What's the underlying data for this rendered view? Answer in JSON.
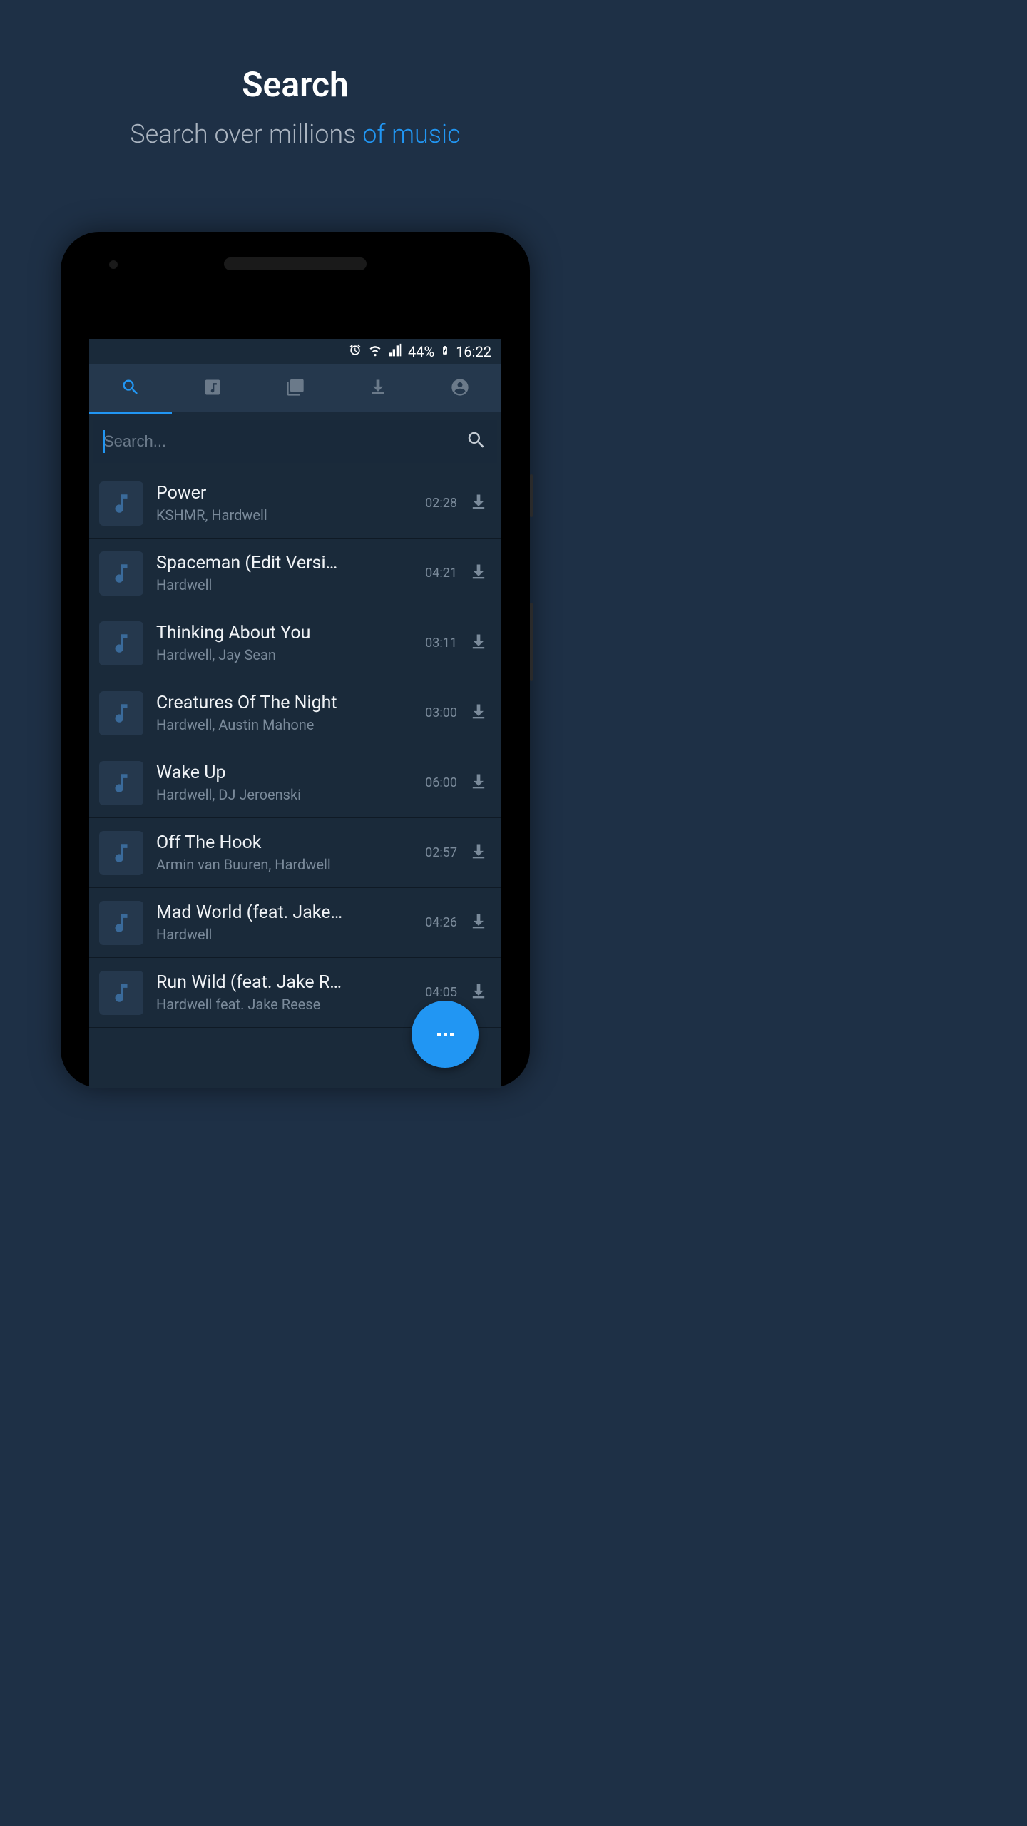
{
  "hero": {
    "title": "Search",
    "subtitle_main": "Search over millions ",
    "subtitle_accent": "of music"
  },
  "statusbar": {
    "battery_percent": "44%",
    "time": "16:22"
  },
  "search": {
    "placeholder": "Search..."
  },
  "tracks": [
    {
      "title": "Power",
      "artist": "KSHMR, Hardwell",
      "duration": "02:28"
    },
    {
      "title": "Spaceman (Edit Versi…",
      "artist": "Hardwell",
      "duration": "04:21"
    },
    {
      "title": "Thinking About You",
      "artist": "Hardwell, Jay Sean",
      "duration": "03:11"
    },
    {
      "title": "Creatures Of The Night",
      "artist": "Hardwell, Austin Mahone",
      "duration": "03:00"
    },
    {
      "title": "Wake Up",
      "artist": "Hardwell, DJ Jeroenski",
      "duration": "06:00"
    },
    {
      "title": "Off The Hook",
      "artist": "Armin van Buuren, Hardwell",
      "duration": "02:57"
    },
    {
      "title": "Mad World (feat. Jake…",
      "artist": "Hardwell",
      "duration": "04:26"
    },
    {
      "title": "Run Wild (feat. Jake R…",
      "artist": "Hardwell feat. Jake Reese",
      "duration": "04:05"
    }
  ]
}
